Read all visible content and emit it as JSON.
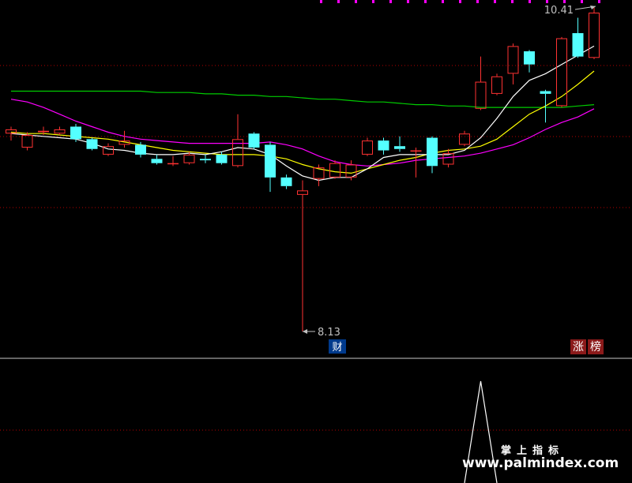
{
  "chart_data": {
    "type": "candlestick",
    "xlabel": "",
    "ylabel": "",
    "ylim": [
      7.8,
      10.5
    ],
    "grid": "horizontal dashed red",
    "candles": [
      {
        "o": 9.45,
        "c": 9.48,
        "h": 9.5,
        "l": 9.4
      },
      {
        "o": 9.35,
        "c": 9.44,
        "h": 9.46,
        "l": 9.33
      },
      {
        "o": 9.46,
        "c": 9.47,
        "h": 9.5,
        "l": 9.44
      },
      {
        "o": 9.45,
        "c": 9.48,
        "h": 9.5,
        "l": 9.44
      },
      {
        "o": 9.5,
        "c": 9.41,
        "h": 9.52,
        "l": 9.39
      },
      {
        "o": 9.41,
        "c": 9.34,
        "h": 9.42,
        "l": 9.33
      },
      {
        "o": 9.3,
        "c": 9.36,
        "h": 9.38,
        "l": 9.29
      },
      {
        "o": 9.37,
        "c": 9.4,
        "h": 9.47,
        "l": 9.35
      },
      {
        "o": 9.37,
        "c": 9.3,
        "h": 9.39,
        "l": 9.28
      },
      {
        "o": 9.27,
        "c": 9.24,
        "h": 9.3,
        "l": 9.23
      },
      {
        "o": 9.24,
        "c": 9.24,
        "h": 9.29,
        "l": 9.22
      },
      {
        "o": 9.24,
        "c": 9.3,
        "h": 9.32,
        "l": 9.23
      },
      {
        "o": 9.27,
        "c": 9.26,
        "h": 9.3,
        "l": 9.24
      },
      {
        "o": 9.3,
        "c": 9.24,
        "h": 9.32,
        "l": 9.23
      },
      {
        "o": 9.22,
        "c": 9.41,
        "h": 9.59,
        "l": 9.21
      },
      {
        "o": 9.45,
        "c": 9.35,
        "h": 9.46,
        "l": 9.34
      },
      {
        "o": 9.37,
        "c": 9.14,
        "h": 9.39,
        "l": 9.04
      },
      {
        "o": 9.14,
        "c": 9.08,
        "h": 9.16,
        "l": 9.06
      },
      {
        "o": 9.02,
        "c": 9.05,
        "h": 9.12,
        "l": 8.13
      },
      {
        "o": 9.13,
        "c": 9.21,
        "h": 9.23,
        "l": 9.08
      },
      {
        "o": 9.14,
        "c": 9.24,
        "h": 9.26,
        "l": 9.13
      },
      {
        "o": 9.14,
        "c": 9.23,
        "h": 9.26,
        "l": 9.12
      },
      {
        "o": 9.3,
        "c": 9.4,
        "h": 9.42,
        "l": 9.29
      },
      {
        "o": 9.4,
        "c": 9.33,
        "h": 9.42,
        "l": 9.3
      },
      {
        "o": 9.36,
        "c": 9.34,
        "h": 9.43,
        "l": 9.32
      },
      {
        "o": 9.33,
        "c": 9.33,
        "h": 9.35,
        "l": 9.14
      },
      {
        "o": 9.42,
        "c": 9.22,
        "h": 9.43,
        "l": 9.17
      },
      {
        "o": 9.23,
        "c": 9.31,
        "h": 9.34,
        "l": 9.21
      },
      {
        "o": 9.37,
        "c": 9.45,
        "h": 9.47,
        "l": 9.36
      },
      {
        "o": 9.63,
        "c": 9.83,
        "h": 10.02,
        "l": 9.62
      },
      {
        "o": 9.74,
        "c": 9.87,
        "h": 9.89,
        "l": 9.73
      },
      {
        "o": 9.89,
        "c": 10.1,
        "h": 10.12,
        "l": 9.81
      },
      {
        "o": 10.06,
        "c": 9.96,
        "h": 10.07,
        "l": 9.9
      },
      {
        "o": 9.76,
        "c": 9.74,
        "h": 9.77,
        "l": 9.53
      },
      {
        "o": 9.65,
        "c": 10.16,
        "h": 10.17,
        "l": 9.64
      },
      {
        "o": 10.2,
        "c": 10.02,
        "h": 10.32,
        "l": 10.01
      },
      {
        "o": 10.01,
        "c": 10.36,
        "h": 10.41,
        "l": 10.0
      }
    ],
    "series": [
      {
        "color": "#00cc00",
        "values": [
          9.76,
          9.76,
          9.76,
          9.76,
          9.76,
          9.76,
          9.76,
          9.76,
          9.76,
          9.75,
          9.75,
          9.75,
          9.74,
          9.74,
          9.73,
          9.73,
          9.72,
          9.72,
          9.71,
          9.7,
          9.7,
          9.69,
          9.68,
          9.68,
          9.67,
          9.66,
          9.66,
          9.65,
          9.65,
          9.64,
          9.64,
          9.64,
          9.64,
          9.64,
          9.64,
          9.65,
          9.66
        ]
      },
      {
        "color": "#ff00ff",
        "values": [
          9.7,
          9.68,
          9.64,
          9.59,
          9.54,
          9.5,
          9.46,
          9.43,
          9.41,
          9.4,
          9.39,
          9.38,
          9.38,
          9.38,
          9.38,
          9.38,
          9.39,
          9.37,
          9.34,
          9.29,
          9.25,
          9.23,
          9.22,
          9.23,
          9.24,
          9.26,
          9.27,
          9.28,
          9.29,
          9.31,
          9.34,
          9.37,
          9.42,
          9.48,
          9.53,
          9.57,
          9.63
        ]
      },
      {
        "color": "#ffff00",
        "values": [
          9.46,
          9.45,
          9.45,
          9.44,
          9.43,
          9.42,
          9.41,
          9.39,
          9.37,
          9.35,
          9.33,
          9.32,
          9.31,
          9.3,
          9.3,
          9.3,
          9.29,
          9.27,
          9.23,
          9.2,
          9.18,
          9.17,
          9.2,
          9.23,
          9.26,
          9.28,
          9.31,
          9.33,
          9.34,
          9.36,
          9.41,
          9.5,
          9.59,
          9.65,
          9.72,
          9.81,
          9.91
        ]
      },
      {
        "color": "#ffffff",
        "values": [
          9.45,
          9.44,
          9.43,
          9.42,
          9.41,
          9.38,
          9.34,
          9.33,
          9.31,
          9.3,
          9.3,
          9.31,
          9.3,
          9.32,
          9.35,
          9.34,
          9.3,
          9.22,
          9.15,
          9.12,
          9.14,
          9.14,
          9.2,
          9.28,
          9.3,
          9.3,
          9.3,
          9.3,
          9.33,
          9.42,
          9.56,
          9.72,
          9.84,
          9.89,
          9.96,
          10.03,
          10.1
        ]
      }
    ],
    "annotations": {
      "high_label": "10.41",
      "low_label": "8.13",
      "low_marker": "财",
      "zt_badge": [
        "涨",
        "榜"
      ]
    },
    "indicator": {
      "values": [
        0,
        0,
        0,
        0,
        0,
        0,
        0,
        0,
        0,
        0,
        0,
        0,
        0,
        0,
        0,
        0,
        0,
        0,
        0,
        0,
        0,
        0,
        0,
        0,
        0,
        0,
        0,
        0,
        0,
        1,
        0,
        0,
        0,
        0,
        0,
        0,
        0
      ]
    }
  },
  "watermark": {
    "title": "掌上指标",
    "url": "www.palmindex.com"
  },
  "colors": {
    "up": "#ff3232",
    "down": "#54ffff",
    "grid": "#b40000",
    "divider": "#c8c8c8",
    "high_label": "#c0c0c0",
    "low_label": "#c0c0c0",
    "badge_bg": "#8b1a1a",
    "badge_text": "#ffffff",
    "marker_bg": "#003a8c",
    "marker_text": "#ffffff",
    "indicator": "#ffffff"
  }
}
